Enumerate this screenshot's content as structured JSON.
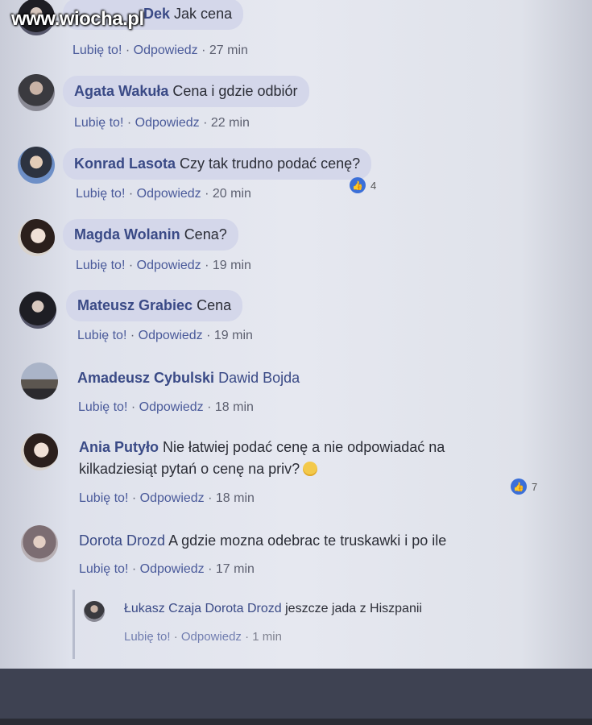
{
  "watermark": "www.wiocha.pl",
  "comments": [
    {
      "name": "Dek",
      "text": "Jak cena",
      "like": "Lubię to!",
      "reply": "Odpowiedz",
      "time": "27 min"
    },
    {
      "name": "Agata Wakuła",
      "text": "Cena i gdzie odbiór",
      "like": "Lubię to!",
      "reply": "Odpowiedz",
      "time": "22 min"
    },
    {
      "name": "Konrad Lasota",
      "text": "Czy tak trudno podać cenę?",
      "like": "Lubię to!",
      "reply": "Odpowiedz",
      "time": "20 min",
      "reactions": "4"
    },
    {
      "name": "Magda Wolanin",
      "text": "Cena?",
      "like": "Lubię to!",
      "reply": "Odpowiedz",
      "time": "19 min"
    },
    {
      "name": "Mateusz Grabiec",
      "text": "Cena",
      "like": "Lubię to!",
      "reply": "Odpowiedz",
      "time": "19 min"
    },
    {
      "name": "Amadeusz Cybulski",
      "text": "Dawid Bojda",
      "like": "Lubię to!",
      "reply": "Odpowiedz",
      "time": "18 min"
    },
    {
      "name": "Ania Putyło",
      "text": "Nie łatwiej podać cenę a nie odpowiadać na",
      "text2": "kilkadziesiąt pytań o cenę na priv?",
      "like": "Lubię to!",
      "reply": "Odpowiedz",
      "time": "18 min",
      "reactions": "7"
    },
    {
      "name": "Dorota Drozd",
      "text": "A gdzie mozna odebrac te truskawki i po ile",
      "like": "Lubię to!",
      "reply": "Odpowiedz",
      "time": "17 min"
    }
  ],
  "reply_comment": {
    "name": "Łukasz Czaja",
    "tag": "Dorota Drozd",
    "text": "jeszcze jada z Hiszpanii",
    "like": "Lubię to!",
    "reply": "Odpowiedz",
    "time": "1 min"
  },
  "separator": "·",
  "colors": {
    "name": "#3a4a86",
    "bubble": "#d4d7ea",
    "like": "#3b6fd8"
  },
  "icons": {
    "reaction": "thumbs-up-icon",
    "emoji": "smiling-face-icon"
  }
}
